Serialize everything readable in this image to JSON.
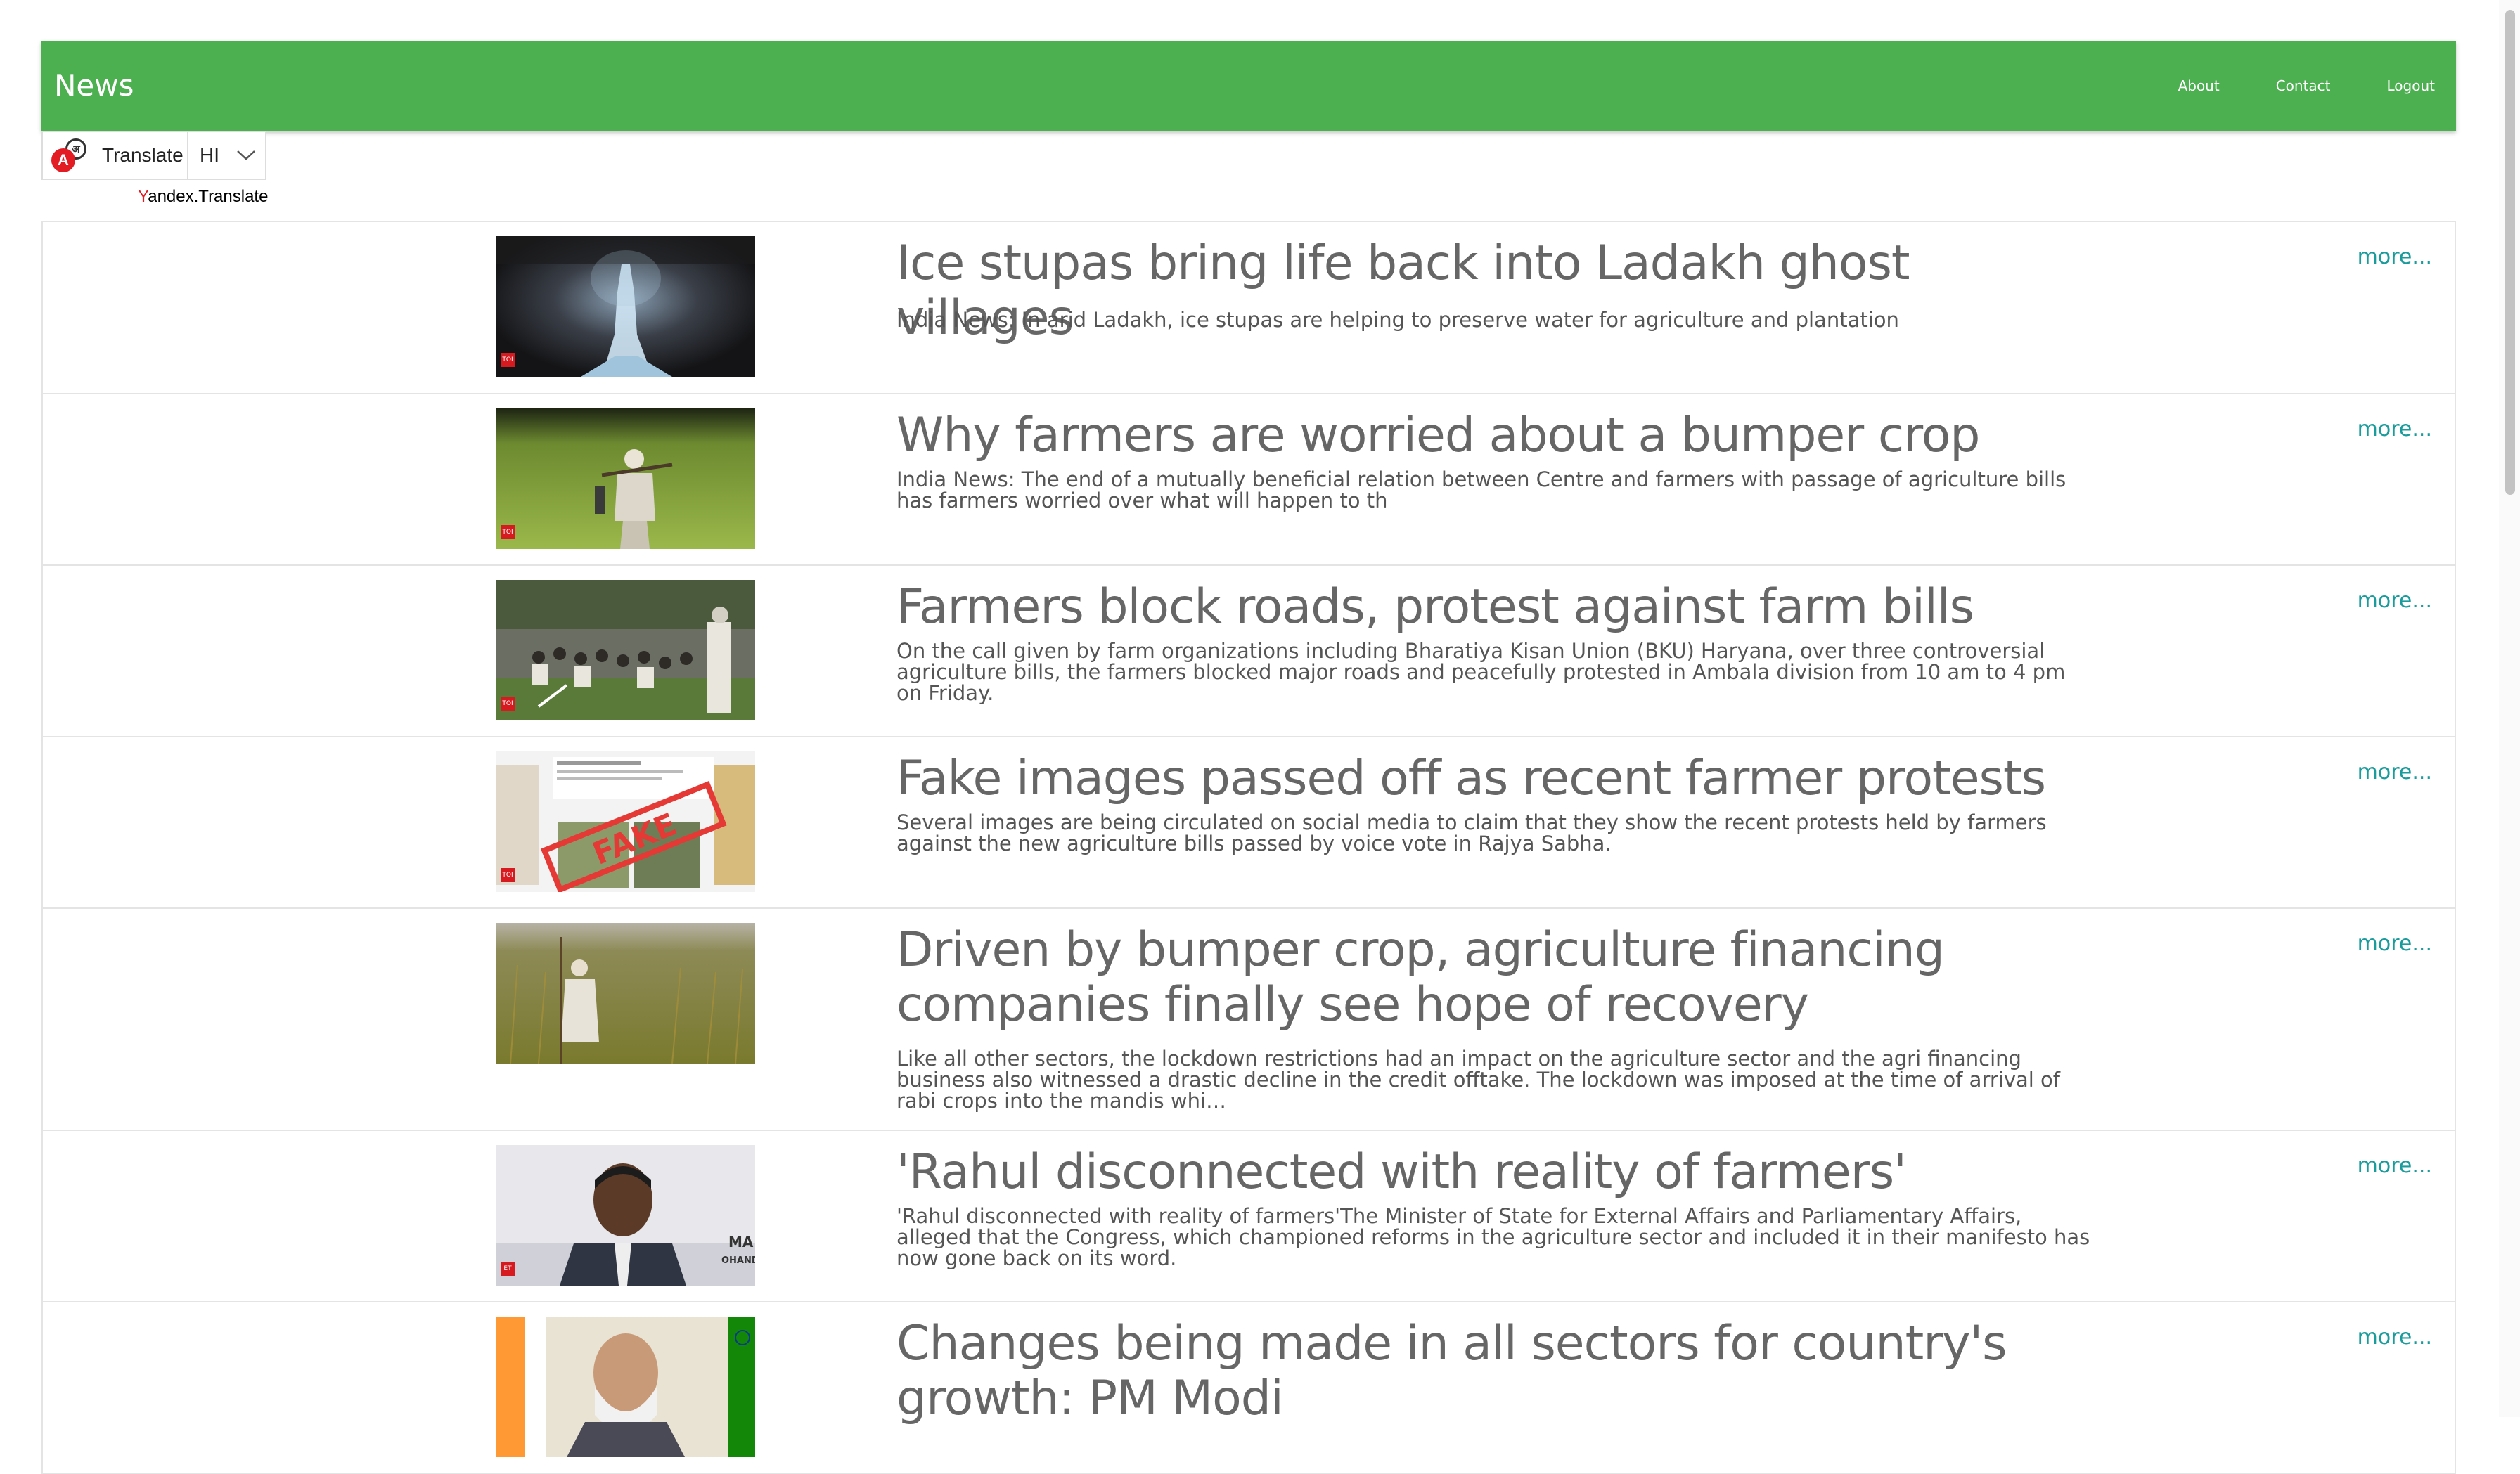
{
  "header": {
    "brand": "News",
    "nav": [
      {
        "label": "About"
      },
      {
        "label": "Contact"
      },
      {
        "label": "Logout"
      }
    ]
  },
  "translate": {
    "label": "Translate",
    "language": "HI",
    "powered_by_first": "Y",
    "powered_by_rest": "andex.Translate",
    "icon_letters": [
      "A",
      "अ"
    ]
  },
  "colors": {
    "navbar": "#4caf50",
    "more_link": "#1a9c9c",
    "headline": "#666666"
  },
  "news": [
    {
      "title": "Ice stupas bring life back into Ladakh ghost villages",
      "description": "India News: In arid Ladakh, ice stupas are helping to preserve water for agriculture and plantation",
      "more": "more...",
      "badge": "TOI",
      "thumb": "ice-stupa"
    },
    {
      "title": "Why farmers are worried about a bumper crop",
      "description": "India News: The end of a mutually beneficial relation between Centre and farmers with passage of agriculture bills has farmers worried over what will happen to th",
      "more": "more...",
      "badge": "TOI",
      "thumb": "farmer-field"
    },
    {
      "title": "Farmers block roads, protest against farm bills",
      "description": "On the call given by farm organizations including Bharatiya Kisan Union (BKU) Haryana, over three controversial agriculture bills, the farmers blocked major roads and peacefully protested in Ambala division from 10 am to 4 pm on Friday.",
      "more": "more...",
      "badge": "TOI",
      "thumb": "protest-crowd"
    },
    {
      "title": "Fake images passed off as recent farmer protests",
      "description": "Several images are being circulated on social media to claim that they show the recent protests held by farmers against the new agriculture bills passed by voice vote in Rajya Sabha.",
      "more": "more...",
      "badge": "TOI",
      "thumb": "fake-stamp",
      "stamp": "FAKE"
    },
    {
      "title": "Driven by bumper crop, agriculture financing companies finally see hope of recovery",
      "description": "Like all other sectors, the lockdown restrictions had an impact on the agriculture sector and the agri financing business also witnessed a drastic decline in the credit offtake. The lockdown was imposed at the time of arrival of rabi crops into the mandis whi…",
      "more": "more...",
      "badge": "",
      "thumb": "wheat-field"
    },
    {
      "title": "'Rahul disconnected with reality of farmers'",
      "description": "'Rahul disconnected with reality of farmers'The Minister of State for External Affairs and Parliamentary Affairs, alleged that the Congress, which championed reforms in the agriculture sector and included it in their manifesto has now gone back on its word.",
      "more": "more...",
      "badge": "ET",
      "thumb": "minister-portrait",
      "thumb_text": [
        "MA",
        "OHAND"
      ]
    },
    {
      "title": "Changes being made in all sectors for country's growth: PM Modi",
      "description": "",
      "more": "more...",
      "badge": "",
      "thumb": "pm-portrait"
    }
  ]
}
